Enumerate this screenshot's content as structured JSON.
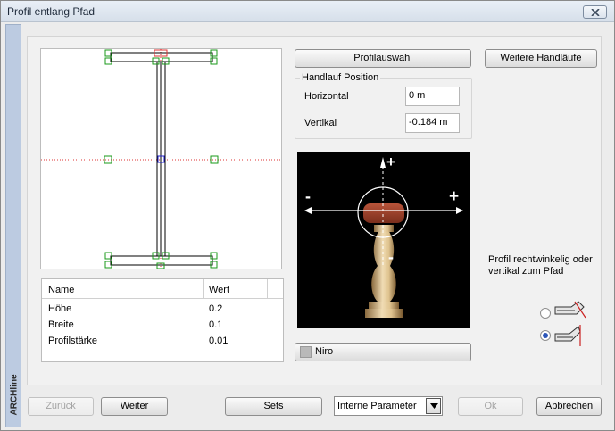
{
  "window": {
    "title": "Profil entlang Pfad",
    "brand": "ARCHline"
  },
  "properties_table": {
    "headers": [
      "Name",
      "Wert"
    ],
    "rows": [
      {
        "name": "Höhe",
        "value": "0.2"
      },
      {
        "name": "Breite",
        "value": "0.1"
      },
      {
        "name": "Profilstärke",
        "value": "0.01"
      }
    ]
  },
  "buttons": {
    "profile_select": "Profilauswahl",
    "more_handrails": "Weitere Handläufe",
    "material": "Niro",
    "back": "Zurück",
    "next": "Weiter",
    "sets": "Sets",
    "ok": "Ok",
    "cancel": "Abbrechen"
  },
  "handrail_position": {
    "title": "Handlauf Position",
    "horizontal_label": "Horizontal",
    "horizontal_value": "0 m",
    "vertical_label": "Vertikal",
    "vertical_value": "-0.184 m"
  },
  "viewer": {
    "plus_up": "+",
    "minus_left": "-",
    "plus_right": "+",
    "minus_down": "-"
  },
  "orientation": {
    "note": "Profil rechtwinkelig oder vertikal zum Pfad",
    "options": [
      {
        "value": "rechtwinkelig",
        "checked": false
      },
      {
        "value": "vertikal",
        "checked": true
      }
    ]
  },
  "parameters_select": {
    "value": "Interne Parameter"
  },
  "icons": [
    "close-icon",
    "dropdown-arrow-icon",
    "profile-perpendicular-icon",
    "profile-vertical-icon",
    "material-swatch-icon"
  ]
}
